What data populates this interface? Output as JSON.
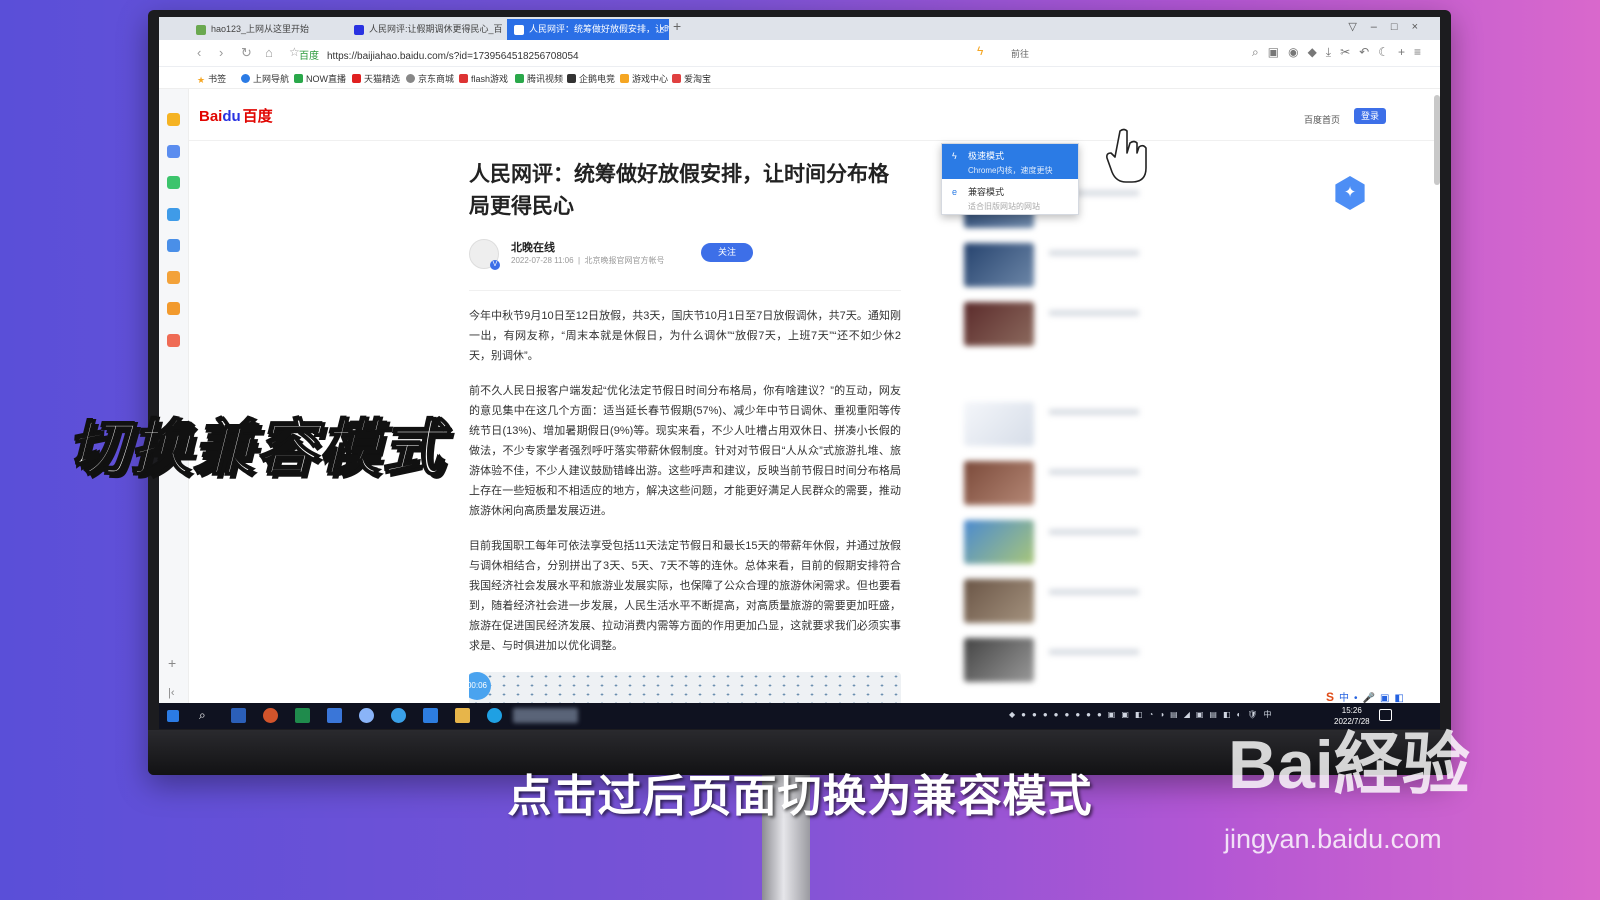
{
  "browser": {
    "tabs": [
      {
        "label": "hao123_上网从这里开始",
        "active": false
      },
      {
        "label": "人民网评:让假期调休更得民心_百度百",
        "active": false
      },
      {
        "label": "人民网评：统筹做好放假安排，让时",
        "active": true
      }
    ],
    "tab_close": "×",
    "new_tab": "+",
    "url_domain": "百度",
    "url": "https://baijiahao.baidu.com/s?id=1739564518256708054",
    "forward_label": "前往",
    "bookmarks": [
      "书签",
      "上网导航",
      "NOW直播",
      "天猫精选",
      "京东商城",
      "flash游戏",
      "腾讯视频",
      "企鹅电竞",
      "游戏中心",
      "爱淘宝"
    ]
  },
  "kernel_menu": {
    "options": [
      {
        "name": "极速模式",
        "desc": "Chrome内核，速度更快"
      },
      {
        "name": "兼容模式",
        "desc": "适合旧版网站的网站"
      }
    ]
  },
  "site": {
    "logo_en": "Bai",
    "logo_paw": "du",
    "logo_cn": "百度",
    "home_link": "百度首页",
    "login": "登录"
  },
  "article": {
    "title": "人民网评：统筹做好放假安排，让时间分布格局更得民心",
    "author": "北晚在线",
    "date": "2022-07-28 11:06",
    "account_desc": "北京晚报官网官方帐号",
    "follow": "关注",
    "paragraphs": [
      "今年中秋节9月10日至12日放假，共3天，国庆节10月1日至7日放假调休，共7天。通知刚一出，有网友称，“周末本就是休假日，为什么调休”“放假7天，上班7天”“还不如少休2天，别调休”。",
      "前不久人民日报客户端发起“优化法定节假日时间分布格局，你有啥建议？”的互动，网友的意见集中在这几个方面：适当延长春节假期(57%)、减少年中节日调休、重视重阳等传统节日(13%)、增加暑期假日(9%)等。现实来看，不少人吐槽占用双休日、拼凑小长假的做法，不少专家学者强烈呼吁落实带薪休假制度。针对对节假日“人从众”式旅游扎堆、旅游体验不佳，不少人建议鼓励错峰出游。这些呼声和建议，反映当前节假日时间分布格局上存在一些短板和不相适应的地方，解决这些问题，才能更好满足人民群众的需要，推动旅游休闲向高质量发展迈进。",
      "目前我国职工每年可依法享受包括11天法定节假日和最长15天的带薪年休假，并通过放假与调休相结合，分别拼出了3天、5天、7天不等的连休。总体来看，目前的假期安排符合我国经济社会发展水平和旅游业发展实际，也保障了公众合理的旅游休闲需求。但也要看到，随着经济社会进一步发展，人民生活水平不断提高，对高质量旅游的需要更加旺盛，旅游在促进国民经济发展、拉动消费内需等方面的作用更加凸显，这就要求我们必须实事求是、与时俱进加以优化调整。"
    ],
    "video_time": "00:06"
  },
  "taskbar": {
    "time": "15:26",
    "date": "2022/7/28",
    "ime": "中"
  },
  "overlay": {
    "title": "切换兼容模式",
    "subtitle": "点击过后页面切换为兼容模式"
  },
  "watermark": {
    "logo": "Bai経验",
    "url": "jingyan.baidu.com"
  },
  "colors": {
    "accent": "#2b7be5",
    "baidu_red": "#e10602",
    "baidu_blue": "#2932e1"
  }
}
